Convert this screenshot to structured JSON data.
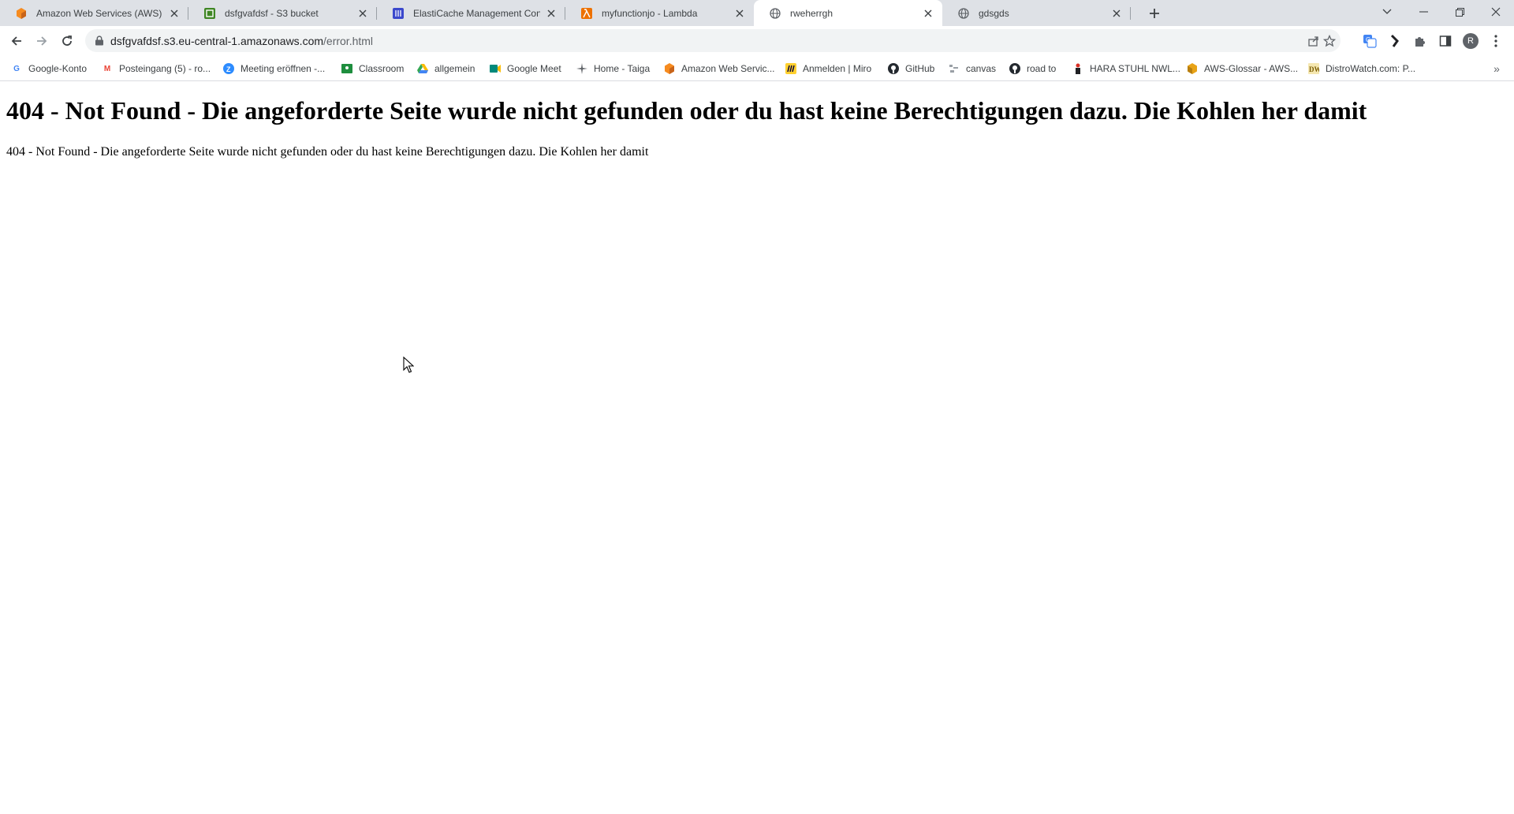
{
  "tabs": [
    {
      "title": "Amazon Web Services (AWS)",
      "favicon": "aws-cube-icon",
      "active": false
    },
    {
      "title": "dsfgvafdsf - S3 bucket",
      "favicon": "s3-bucket-icon",
      "active": false
    },
    {
      "title": "ElastiCache Management Consol",
      "favicon": "elasticache-icon",
      "active": false
    },
    {
      "title": "myfunctionjo - Lambda",
      "favicon": "lambda-icon",
      "active": false
    },
    {
      "title": "rweherrgh",
      "favicon": "globe-icon",
      "active": true
    },
    {
      "title": "gdsgds",
      "favicon": "globe-icon",
      "active": false
    }
  ],
  "address": {
    "host": "dsfgvafdsf.s3.eu-central-1.amazonaws.com",
    "path": "/error.html"
  },
  "bookmarks": [
    {
      "label": "Google-Konto",
      "icon": "google-icon",
      "color": "#4285f4"
    },
    {
      "label": "Posteingang (5) - ro...",
      "icon": "gmail-icon",
      "color": "#ea4335"
    },
    {
      "label": "Meeting eröffnen -...",
      "icon": "zoom-icon",
      "color": "#2d8cff"
    },
    {
      "label": "Classroom",
      "icon": "classroom-icon",
      "color": "#1e8e3e"
    },
    {
      "label": "allgemein",
      "icon": "drive-icon",
      "color": "#fbbc04"
    },
    {
      "label": "Google Meet",
      "icon": "meet-icon",
      "color": "#00897b"
    },
    {
      "label": "Home - Taiga",
      "icon": "taiga-icon",
      "color": "#5f6368"
    },
    {
      "label": "Amazon Web Servic...",
      "icon": "aws-cube-icon",
      "color": "#f68b1f"
    },
    {
      "label": "Anmelden | Miro",
      "icon": "miro-icon",
      "color": "#ffd02f"
    },
    {
      "label": "GitHub",
      "icon": "github-icon",
      "color": "#24292f"
    },
    {
      "label": "canvas",
      "icon": "canvas-icon",
      "color": "#9aa0a6"
    },
    {
      "label": "road to",
      "icon": "github-icon",
      "color": "#24292f"
    },
    {
      "label": "HARA STUHL NWL...",
      "icon": "hara-icon",
      "color": "#d93025"
    },
    {
      "label": "AWS-Glossar - AWS...",
      "icon": "aws-glossary-icon",
      "color": "#e8a317"
    },
    {
      "label": "DistroWatch.com: P...",
      "icon": "distrowatch-icon",
      "color": "#7a5c00"
    }
  ],
  "profile_initial": "R",
  "page": {
    "heading": "404 - Not Found - Die angeforderte Seite wurde nicht gefunden oder du hast keine Berechtigungen dazu. Die Kohlen her damit",
    "paragraph": "404 - Not Found - Die angeforderte Seite wurde nicht gefunden oder du hast keine Berechtigungen dazu. Die Kohlen her damit"
  }
}
